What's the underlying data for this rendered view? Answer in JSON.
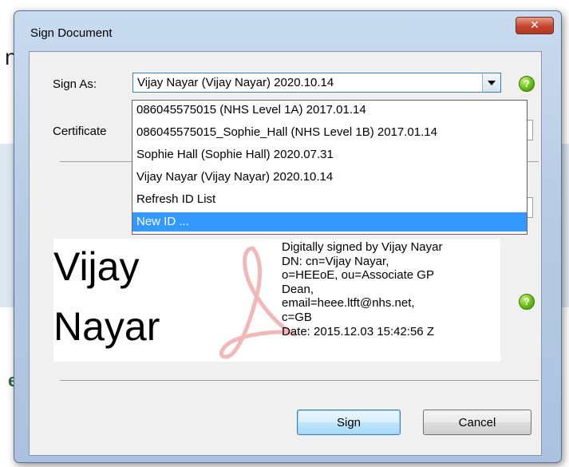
{
  "background": {
    "partial_left_text": "n",
    "partial_bottom_text": "e"
  },
  "dialog": {
    "title": "Sign Document",
    "close_glyph": "✕",
    "sign_as_label": "Sign As:",
    "sign_as_value": "Vijay Nayar (Vijay Nayar) 2020.10.14",
    "certificate_label": "Certificate",
    "help_glyph": "?",
    "dropdown_options": [
      "086045575015 (NHS Level 1A) 2017.01.14",
      "086045575015_Sophie_Hall (NHS Level 1B) 2017.01.14",
      "Sophie Hall (Sophie Hall) 2020.07.31",
      "Vijay Nayar (Vijay Nayar) 2020.10.14",
      "Refresh ID List",
      "New ID ..."
    ],
    "selected_option_index": 5,
    "appearance": {
      "name_line1": "Vijay",
      "name_line2": "Nayar",
      "details": [
        "Digitally signed by Vijay Nayar",
        "DN: cn=Vijay Nayar,",
        "o=HEEoE, ou=Associate GP",
        "Dean,",
        "email=heee.ltft@nhs.net,",
        "c=GB",
        "Date: 2015.12.03 15:42:56 Z"
      ]
    },
    "sign_button": "Sign",
    "cancel_button": "Cancel"
  },
  "icons": {
    "help": "help-icon",
    "close": "close-icon",
    "dropdown_arrow": "chevron-down-icon",
    "watermark": "acrobat-logo-watermark"
  },
  "colors": {
    "selection": "#3399ff",
    "help_green": "#5fb80f",
    "close_red": "#c3452c"
  }
}
